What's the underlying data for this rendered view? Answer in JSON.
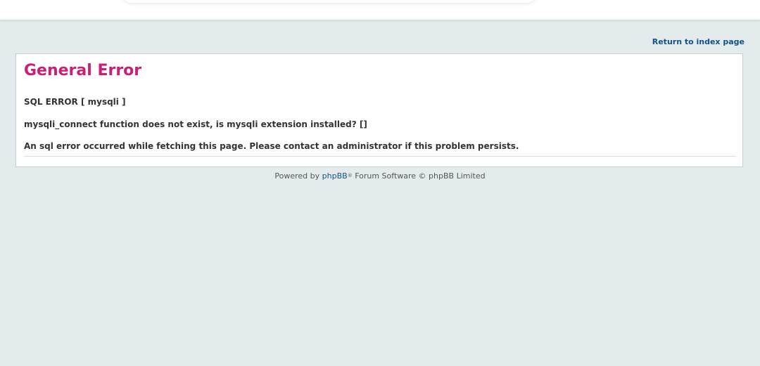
{
  "top_link": "Return to index page",
  "error": {
    "title": "General Error",
    "sql_error": "SQL ERROR [ mysqli ]",
    "message": "mysqli_connect function does not exist, is mysqli extension installed? []",
    "description": "An sql error occurred while fetching this page. Please contact an administrator if this problem persists."
  },
  "footer": {
    "prefix": "Powered by",
    "link": "phpBB",
    "mark": "®",
    "suffix": "Forum Software © phpBB Limited"
  },
  "colors": {
    "page_background": "#e4ebed",
    "title": "#cc1f74",
    "link": "#105289"
  }
}
